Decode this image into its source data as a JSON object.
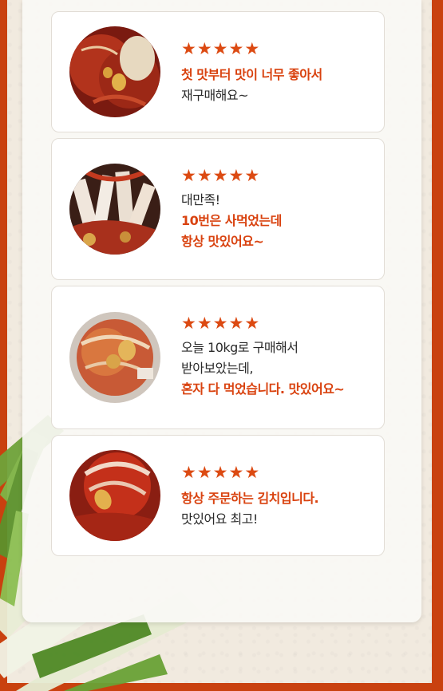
{
  "colors": {
    "accent": "#d9420f",
    "frame": "#c9410f",
    "star": "#dc4a12"
  },
  "rating_icon": "star-icon",
  "reviews": [
    {
      "rating": 5,
      "lines": [
        {
          "text": "첫 맛부터 맛이 너무 좋아서",
          "highlight": true
        },
        {
          "text": "재구매해요~",
          "highlight": false
        }
      ]
    },
    {
      "rating": 5,
      "lines": [
        {
          "text": "대만족!",
          "highlight": false
        },
        {
          "text": "10번은 사먹었는데",
          "highlight": true
        },
        {
          "text": "항상 맛있어요~",
          "highlight": true
        }
      ]
    },
    {
      "rating": 5,
      "lines": [
        {
          "text": "오늘 10kg로 구매해서",
          "highlight": false
        },
        {
          "text": "받아보았는데,",
          "highlight": false
        },
        {
          "text": "혼자 다 먹었습니다. 맛있어요~",
          "highlight": true
        }
      ]
    },
    {
      "rating": 5,
      "lines": [
        {
          "text": "항상 주문하는 김치입니다.",
          "highlight": true
        },
        {
          "text": "맛있어요 최고!",
          "highlight": false
        }
      ]
    }
  ]
}
